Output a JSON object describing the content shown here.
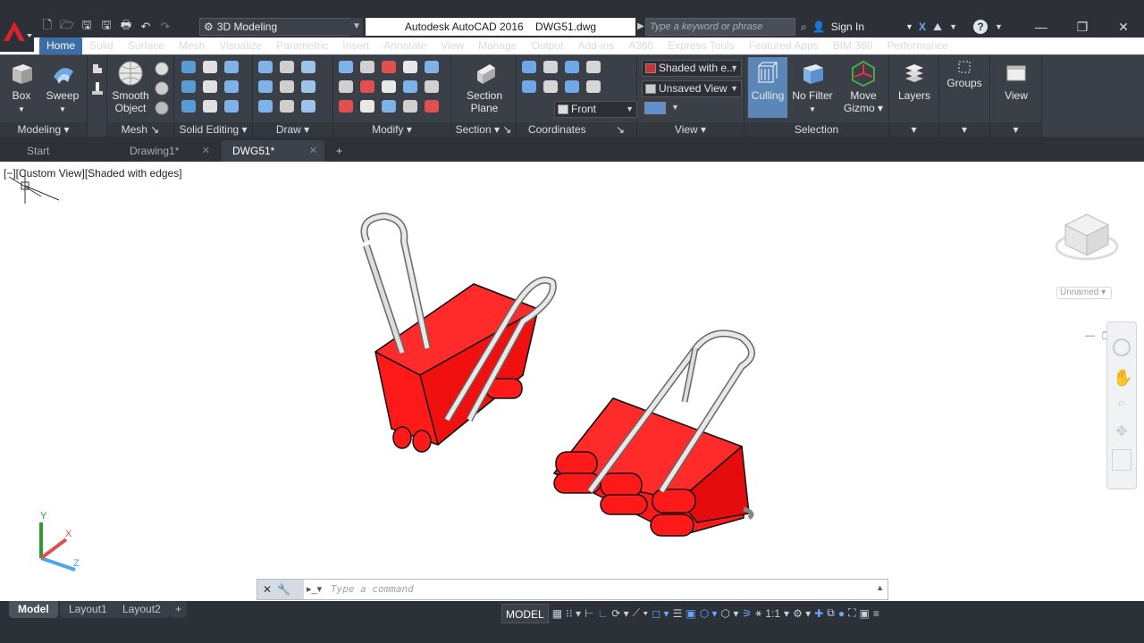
{
  "app": {
    "title": "Autodesk AutoCAD 2016",
    "document": "DWG51.dwg",
    "workspace": "3D Modeling",
    "search_placeholder": "Type a keyword or phrase",
    "sign_in": "Sign In"
  },
  "tabs": [
    "Home",
    "Solid",
    "Surface",
    "Mesh",
    "Visualize",
    "Parametric",
    "Insert",
    "Annotate",
    "View",
    "Manage",
    "Output",
    "Add-ins",
    "A360",
    "Express Tools",
    "Featured Apps",
    "BIM 360",
    "Performance"
  ],
  "ribbon": {
    "modeling": {
      "title": "Modeling",
      "box": "Box",
      "sweep": "Sweep"
    },
    "mesh": {
      "title": "Mesh",
      "smooth1": "Smooth",
      "smooth2": "Object"
    },
    "solid_editing": {
      "title": "Solid Editing"
    },
    "draw": {
      "title": "Draw"
    },
    "modify": {
      "title": "Modify"
    },
    "section": {
      "title": "Section",
      "plane1": "Section",
      "plane2": "Plane"
    },
    "coordinates": {
      "title": "Coordinates"
    },
    "view": {
      "title": "View",
      "visual_style": "Shaded with e...",
      "saved_view": "Unsaved View",
      "ortho": "Front"
    },
    "selection": {
      "title": "Selection",
      "culling": "Culling",
      "no_filter": "No Filter",
      "gizmo1": "Move",
      "gizmo2": "Gizmo"
    },
    "layers": "Layers",
    "groups": "Groups",
    "view_btn": "View"
  },
  "file_tabs": [
    "Start",
    "Drawing1*",
    "DWG51*"
  ],
  "viewport": {
    "label": "[−][Custom View][Shaded with edges]",
    "cube_name": "Unnamed",
    "ucs_x": "X",
    "ucs_y": "Y",
    "ucs_z": "Z"
  },
  "command": {
    "placeholder": "Type a command"
  },
  "layout_tabs": [
    "Model",
    "Layout1",
    "Layout2"
  ],
  "status": {
    "model": "MODEL",
    "scale": "1:1"
  },
  "colors": {
    "accent": "#3b6ea5",
    "clip_red": "#ff1a1a",
    "ribbon_bg": "#3b3f47"
  }
}
